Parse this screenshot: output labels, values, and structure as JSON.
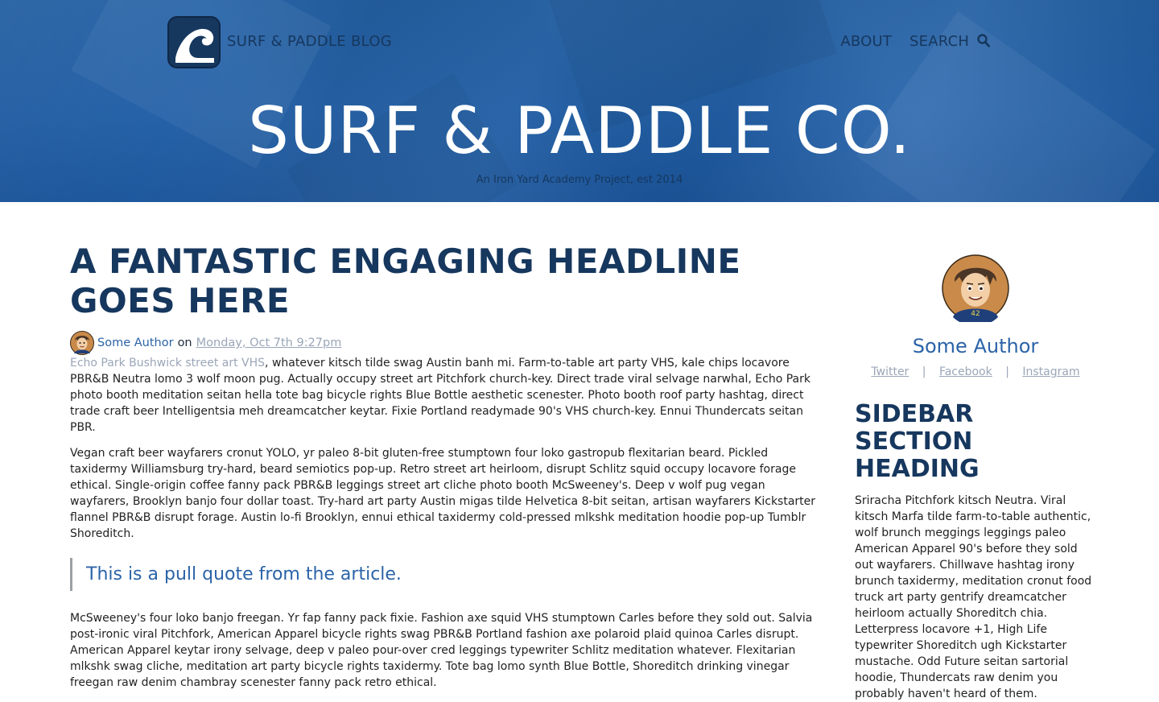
{
  "header": {
    "logo_icon": "wave-icon",
    "brand": "SURF & PADDLE BLOG",
    "nav": [
      {
        "label": "ABOUT"
      },
      {
        "label": "SEARCH",
        "icon": "search-icon"
      }
    ],
    "title": "SURF & PADDLE CO.",
    "subtitle": "An Iron Yard Academy Project, est 2014"
  },
  "article": {
    "headline": "A FANTASTIC ENGAGING HEADLINE GOES HERE",
    "author": "Some Author",
    "on": "on",
    "date": "Monday, Oct 7th 9:27pm",
    "lead_link": "Echo Park Bushwick street art VHS",
    "p1_rest": ", whatever kitsch tilde swag Austin banh mi. Farm-to-table art party VHS, kale chips locavore PBR&B Neutra lomo 3 wolf moon pug. Actually occupy street art Pitchfork church-key. Direct trade viral selvage narwhal, Echo Park photo booth meditation seitan hella tote bag bicycle rights Blue Bottle aesthetic scenester. Photo booth roof party hashtag, direct trade craft beer Intelligentsia meh dreamcatcher keytar. Fixie Portland readymade 90's VHS church-key. Ennui Thundercats seitan PBR.",
    "p2": "Vegan craft beer wayfarers cronut YOLO, yr paleo 8-bit gluten-free stumptown four loko gastropub flexitarian beard. Pickled taxidermy Williamsburg try-hard, beard semiotics pop-up. Retro street art heirloom, disrupt Schlitz squid occupy locavore forage ethical. Single-origin coffee fanny pack PBR&B leggings street art cliche photo booth McSweeney's. Deep v wolf pug vegan wayfarers, Brooklyn banjo four dollar toast. Try-hard art party Austin migas tilde Helvetica 8-bit seitan, artisan wayfarers Kickstarter flannel PBR&B disrupt forage. Austin lo-fi Brooklyn, ennui ethical taxidermy cold-pressed mlkshk meditation hoodie pop-up Tumblr Shoreditch.",
    "pullquote": "This is a pull quote from the article.",
    "p3": "McSweeney's four loko banjo freegan. Yr fap fanny pack fixie. Fashion axe squid VHS stumptown Carles before they sold out. Salvia post-ironic viral Pitchfork, American Apparel bicycle rights swag PBR&B Portland fashion axe polaroid plaid quinoa Carles disrupt. American Apparel keytar irony selvage, deep v paleo pour-over cred leggings typewriter Schlitz meditation whatever. Flexitarian mlkshk swag cliche, meditation art party bicycle rights taxidermy. Tote bag lomo synth Blue Bottle, Shoreditch drinking vinegar freegan raw denim chambray scenester fanny pack retro ethical."
  },
  "sidebar": {
    "author": "Some Author",
    "social": [
      {
        "label": "Twitter"
      },
      {
        "label": "Facebook"
      },
      {
        "label": "Instagram"
      }
    ],
    "separator": "|",
    "heading": "SIDEBAR SECTION HEADING",
    "text": "Sriracha Pitchfork kitsch Neutra. Viral kitsch Marfa tilde farm-to-table authentic, wolf brunch meggings leggings paleo American Apparel 90's before they sold out wayfarers. Chillwave hashtag irony brunch taxidermy, meditation cronut food truck art party gentrify dreamcatcher heirloom actually Shoreditch chia. Letterpress locavore +1, High Life typewriter Shoreditch ugh Kickstarter mustache. Odd Future seitan sartorial hoodie, Thundercats raw denim you probably haven't heard of them."
  },
  "colors": {
    "hero_blue": "#1e5ea8",
    "navy": "#16375e",
    "link_blue": "#2b63a8",
    "muted_link": "#9aa6b8"
  }
}
